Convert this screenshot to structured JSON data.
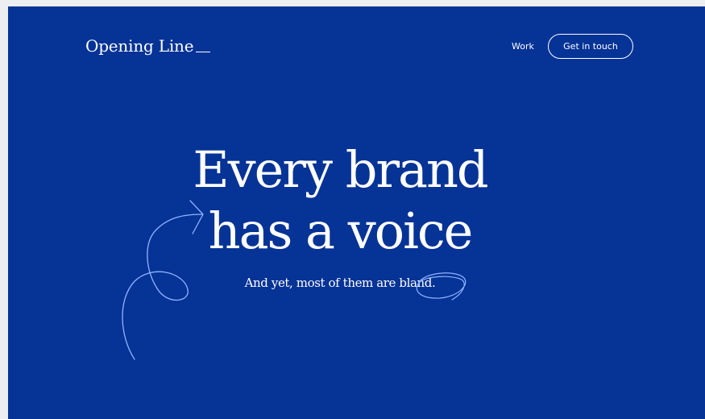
{
  "brand": {
    "name": "Opening Line"
  },
  "nav": {
    "work_label": "Work",
    "cta_label": "Get in touch"
  },
  "hero": {
    "headline_line1": "Every brand",
    "headline_line2": "has a voice",
    "subhead": "And yet, most of them are bland."
  },
  "colors": {
    "background": "#063396",
    "text": "#ffffff",
    "scribble": "#8fb4ff"
  },
  "icons": {
    "arrow": "hand-drawn-arrow-icon",
    "circle": "hand-drawn-circle-icon"
  }
}
